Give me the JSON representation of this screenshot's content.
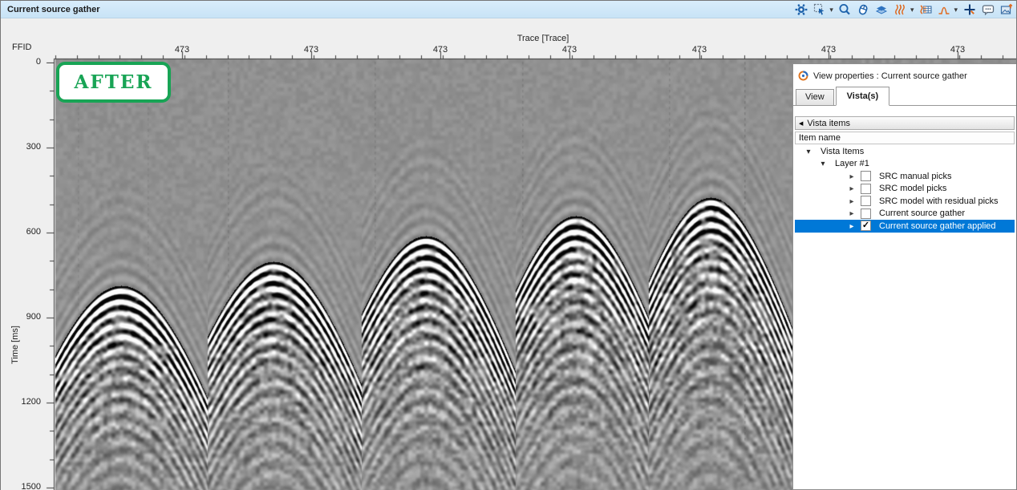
{
  "titlebar": {
    "title": "Current source gather",
    "icons": [
      "settings",
      "selection-mode",
      "zoom",
      "mouse-tool",
      "layers",
      "wiggle-display",
      "spreadsheet",
      "amplitude-histogram",
      "crosshair",
      "comment",
      "export-image"
    ]
  },
  "axes": {
    "corner_label": "FFID",
    "x_title": "Trace [Trace]",
    "x_ticks": [
      "473",
      "473",
      "473",
      "473",
      "473",
      "473",
      "473"
    ],
    "y_title": "Time [ms]",
    "y_ticks": [
      "0",
      "300",
      "600",
      "900",
      "1200",
      "1500"
    ]
  },
  "overlay": {
    "label": "AFTER"
  },
  "panel": {
    "title": "View properties : Current source gather",
    "tabs": [
      {
        "label": "View",
        "active": false
      },
      {
        "label": "Vista(s)",
        "active": true
      }
    ],
    "group_header": "Vista items",
    "column_header": "Item name",
    "tree": [
      {
        "label": "Vista Items",
        "level": 0,
        "expander": "expanded",
        "selected": false
      },
      {
        "label": "Layer #1",
        "level": 1,
        "expander": "expanded",
        "selected": false
      },
      {
        "label": "SRC manual picks",
        "level": 2,
        "expander": "collapsed",
        "checked": false,
        "selected": false
      },
      {
        "label": "SRC model picks",
        "level": 2,
        "expander": "collapsed",
        "checked": false,
        "selected": false
      },
      {
        "label": "SRC model with residual picks",
        "level": 2,
        "expander": "collapsed",
        "checked": false,
        "selected": false
      },
      {
        "label": "Current source gather",
        "level": 2,
        "expander": "collapsed",
        "checked": false,
        "selected": false
      },
      {
        "label": "Current source gather applied",
        "level": 2,
        "expander": "collapsed",
        "checked": true,
        "selected": true
      }
    ]
  },
  "colors": {
    "selection_blue": "#0078d7",
    "title_bar_blue": "#cfe8f8",
    "after_green": "#18a455",
    "accent_blue": "#1d62ab",
    "accent_orange": "#e06a1f",
    "seismic_background_gray": "#909090"
  }
}
